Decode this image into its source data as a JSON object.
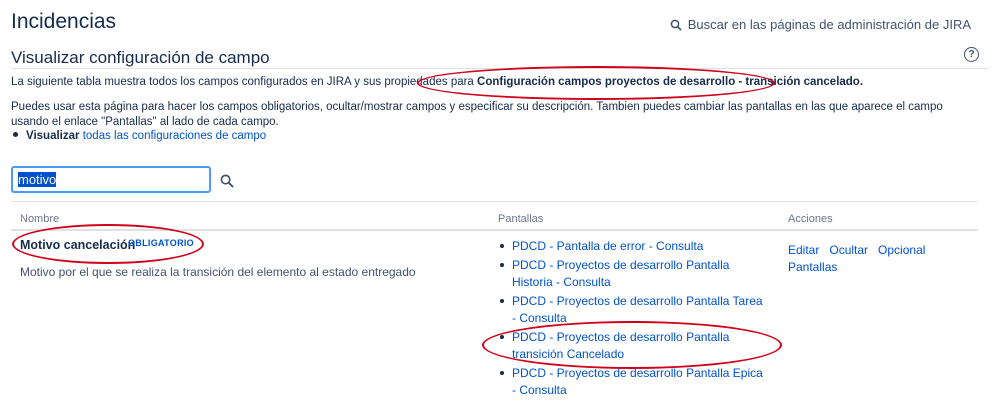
{
  "header": {
    "title": "Incidencias",
    "admin_search": "Buscar en las páginas de administración de JIRA",
    "section_title": "Visualizar configuración de campo",
    "help_icon": "?"
  },
  "intro": {
    "text": "La siguiente tabla muestra todos los campos configurados en JIRA y sus propiedades para",
    "config_name": "Configuración campos proyectos de desarrollo - transición cancelado."
  },
  "description": "Puedes usar esta página para hacer los campos obligatorios, ocultar/mostrar campos y especificar su descripción. Tambien puedes cambiar las pantallas en las que aparece el campo usando el enlace \"Pantallas\" al lado de cada campo.",
  "view_all": {
    "prefix": "Visualizar",
    "link": "todas las configuraciones de campo"
  },
  "filter": {
    "value": "motivo"
  },
  "table": {
    "headers": {
      "name": "Nombre",
      "screens": "Pantallas",
      "actions": "Acciones"
    },
    "row": {
      "name": "Motivo cancelación",
      "badge": "OBLIGATORIO",
      "description": "Motivo por el que se realiza la transición del elemento al estado entregado",
      "screens": [
        "PDCD - Pantalla de error - Consulta",
        "PDCD - Proyectos de desarrollo Pantalla Historia - Consulta",
        "PDCD - Proyectos de desarrollo Pantalla Tarea - Consulta",
        "PDCD - Proyectos de desarrollo Pantalla transición Cancelado",
        "PDCD - Proyectos de desarrollo Pantalla Epica - Consulta"
      ],
      "actions": [
        "Editar",
        "Ocultar",
        "Opcional",
        "Pantallas"
      ]
    }
  },
  "colors": {
    "link": "#0052cc",
    "annotation": "#d0021b",
    "text": "#172b4d"
  }
}
